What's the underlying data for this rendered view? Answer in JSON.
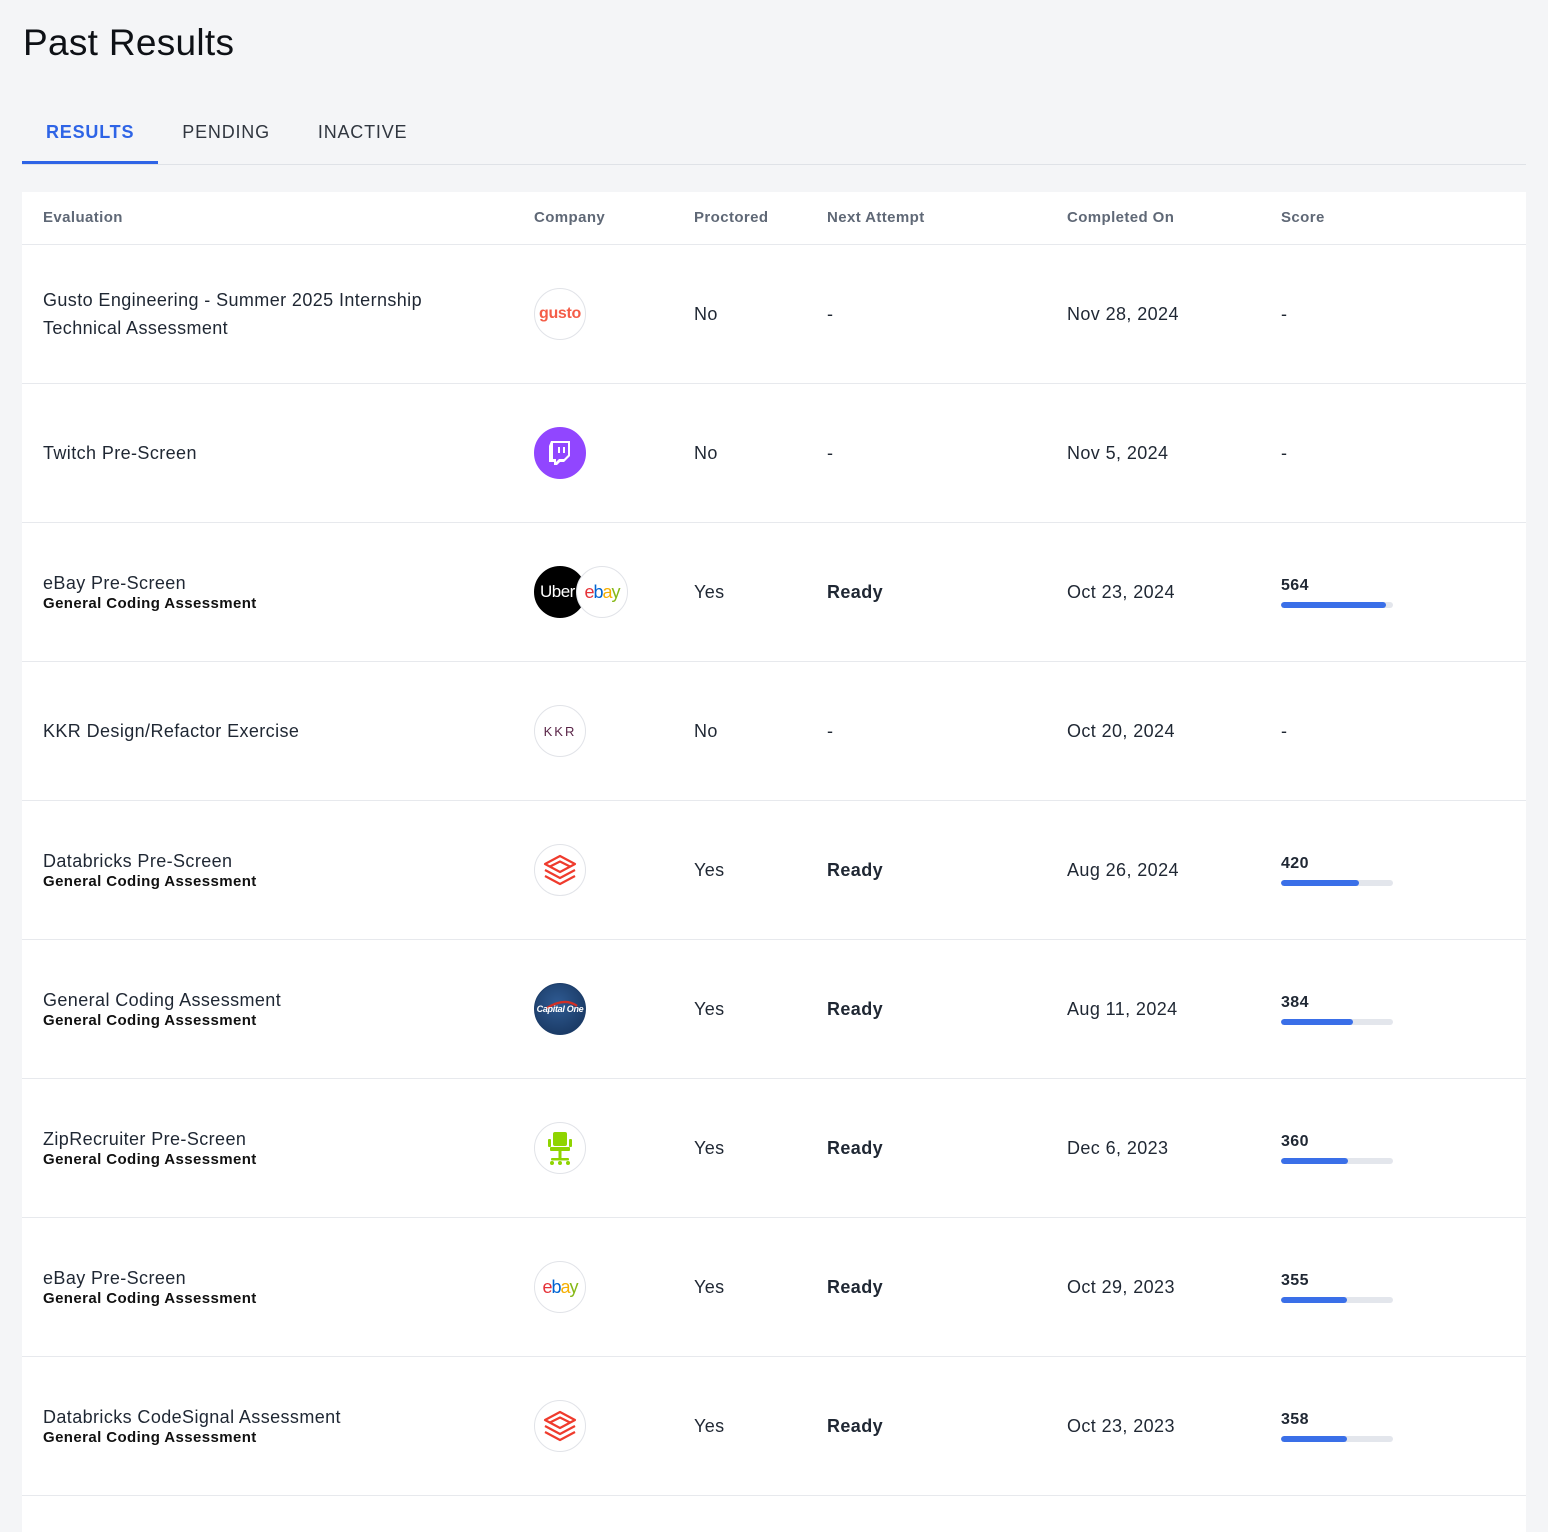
{
  "page": {
    "title": "Past Results"
  },
  "tabs": [
    {
      "label": "RESULTS",
      "active": true
    },
    {
      "label": "PENDING",
      "active": false
    },
    {
      "label": "INACTIVE",
      "active": false
    }
  ],
  "columns": {
    "evaluation": "Evaluation",
    "company": "Company",
    "proctored": "Proctored",
    "next_attempt": "Next Attempt",
    "completed_on": "Completed On",
    "score": "Score"
  },
  "colors": {
    "accent": "#2e64e6",
    "bar_fill": "#3a6fe8",
    "bar_track": "#e3e6ec"
  },
  "rows": [
    {
      "title": "Gusto Engineering - Summer 2025 Internship Technical Assessment",
      "subtitle": "",
      "company_icons": [
        "gusto-logo-icon"
      ],
      "logo_texts": [
        "gusto"
      ],
      "proctored": "No",
      "next_attempt": "-",
      "completed_on": "Nov 28, 2024",
      "score": "-",
      "score_fraction": null
    },
    {
      "title": "Twitch Pre-Screen",
      "subtitle": "",
      "company_icons": [
        "twitch-logo-icon"
      ],
      "logo_texts": [
        ""
      ],
      "proctored": "No",
      "next_attempt": "-",
      "completed_on": "Nov 5, 2024",
      "score": "-",
      "score_fraction": null
    },
    {
      "title": "eBay Pre-Screen",
      "subtitle": "General Coding Assessment",
      "company_icons": [
        "uber-logo-icon",
        "ebay-logo-icon"
      ],
      "logo_texts": [
        "Uber",
        "ebay"
      ],
      "proctored": "Yes",
      "next_attempt": "Ready",
      "completed_on": "Oct 23, 2024",
      "score": "564",
      "score_fraction": 0.94
    },
    {
      "title": "KKR Design/Refactor Exercise",
      "subtitle": "",
      "company_icons": [
        "kkr-logo-icon"
      ],
      "logo_texts": [
        "KKR"
      ],
      "proctored": "No",
      "next_attempt": "-",
      "completed_on": "Oct 20, 2024",
      "score": "-",
      "score_fraction": null
    },
    {
      "title": "Databricks Pre-Screen",
      "subtitle": "General Coding Assessment",
      "company_icons": [
        "databricks-logo-icon"
      ],
      "logo_texts": [
        ""
      ],
      "proctored": "Yes",
      "next_attempt": "Ready",
      "completed_on": "Aug 26, 2024",
      "score": "420",
      "score_fraction": 0.7
    },
    {
      "title": "General Coding Assessment",
      "subtitle": "General Coding Assessment",
      "company_icons": [
        "capital-one-logo-icon"
      ],
      "logo_texts": [
        "Capital One"
      ],
      "proctored": "Yes",
      "next_attempt": "Ready",
      "completed_on": "Aug 11, 2024",
      "score": "384",
      "score_fraction": 0.64
    },
    {
      "title": "ZipRecruiter Pre-Screen",
      "subtitle": "General Coding Assessment",
      "company_icons": [
        "ziprecruiter-logo-icon"
      ],
      "logo_texts": [
        ""
      ],
      "proctored": "Yes",
      "next_attempt": "Ready",
      "completed_on": "Dec 6, 2023",
      "score": "360",
      "score_fraction": 0.6
    },
    {
      "title": "eBay Pre-Screen",
      "subtitle": "General Coding Assessment",
      "company_icons": [
        "ebay-logo-icon"
      ],
      "logo_texts": [
        "ebay"
      ],
      "proctored": "Yes",
      "next_attempt": "Ready",
      "completed_on": "Oct 29, 2023",
      "score": "355",
      "score_fraction": 0.59
    },
    {
      "title": "Databricks CodeSignal Assessment",
      "subtitle": "General Coding Assessment",
      "company_icons": [
        "databricks-logo-icon"
      ],
      "logo_texts": [
        ""
      ],
      "proctored": "Yes",
      "next_attempt": "Ready",
      "completed_on": "Oct 23, 2023",
      "score": "358",
      "score_fraction": 0.59
    }
  ]
}
